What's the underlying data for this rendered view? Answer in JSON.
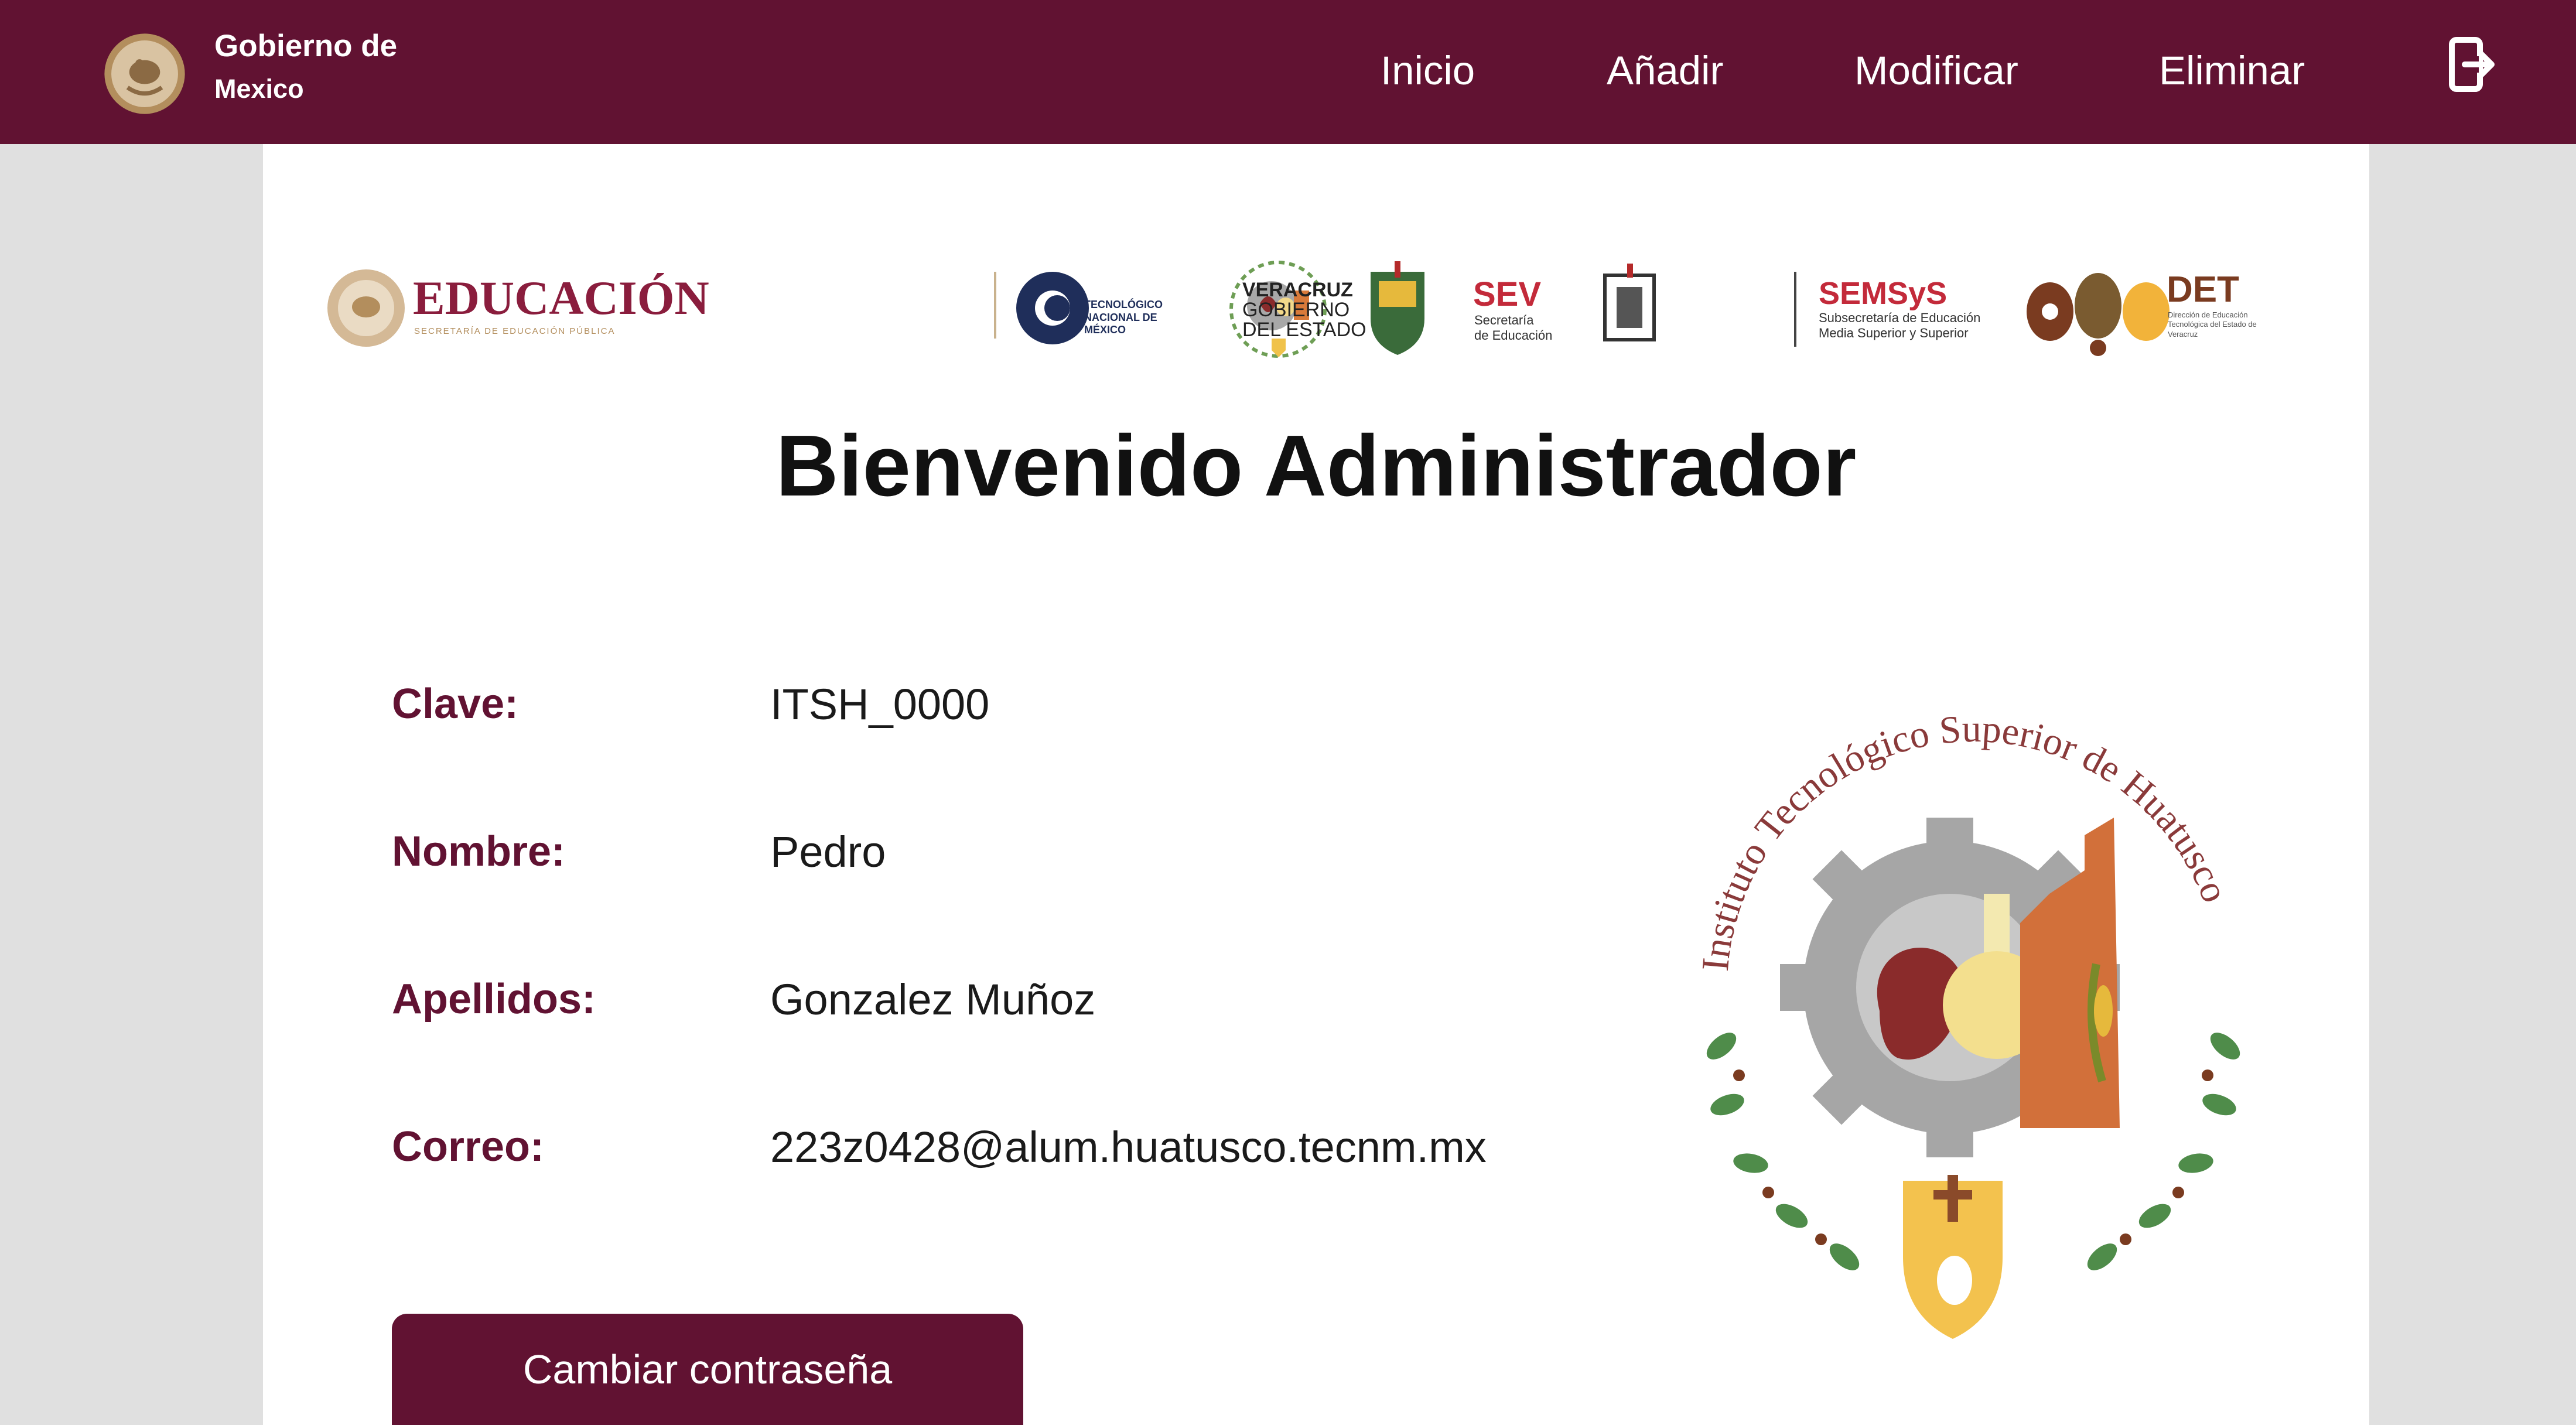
{
  "header": {
    "title_line1": "Gobierno de",
    "title_line2": "Mexico",
    "nav": [
      "Inicio",
      "Añadir",
      "Modificar",
      "Eliminar"
    ],
    "logout_icon": "logout-icon",
    "background_color": "#611232"
  },
  "logos": {
    "educacion": "EDUCACIÓN",
    "educacion_sub": "SECRETARÍA DE EDUCACIÓN PÚBLICA",
    "tecnm": "TECNOLÓGICO NACIONAL DE MÉXICO",
    "veracruz_line1": "VERACRUZ",
    "veracruz_line2": "GOBIERNO",
    "veracruz_line3": "DEL ESTADO",
    "sev": "SEV",
    "sev_sub1": "Secretaría",
    "sev_sub2": "de Educación",
    "semsys": "SEMSyS",
    "semsys_sub1": "Subsecretaría de Educación",
    "semsys_sub2": "Media Superior y Superior",
    "det": "DET",
    "det_sub": "Dirección de Educación Tecnológica del Estado de Veracruz"
  },
  "main": {
    "welcome_title": "Bienvenido Administrador",
    "fields": [
      {
        "label": "Clave:",
        "value": "ITSH_0000"
      },
      {
        "label": "Nombre:",
        "value": "Pedro"
      },
      {
        "label": "Apellidos:",
        "value": "Gonzalez Muñoz"
      },
      {
        "label": "Correo:",
        "value": "223z0428@alum.huatusco.tecnm.mx"
      }
    ],
    "institute_name": "Instituto Tecnológico Superior de Huatusco",
    "change_password_button": "Cambiar contraseña",
    "accent_color": "#611232"
  }
}
